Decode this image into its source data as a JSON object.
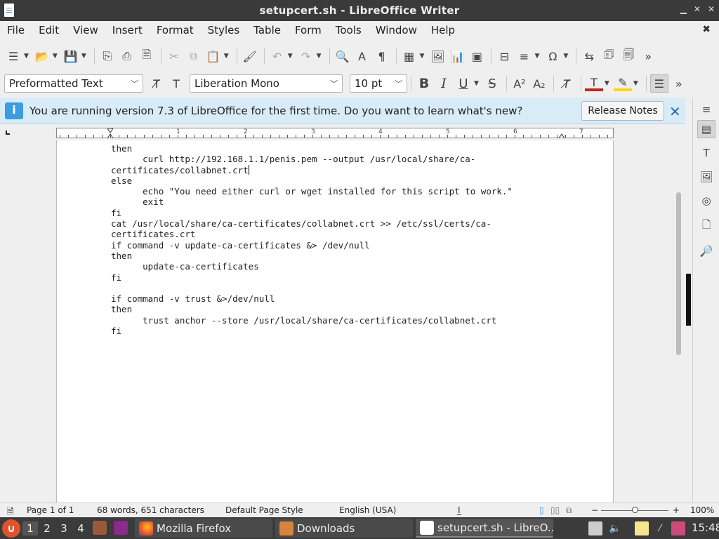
{
  "window": {
    "title": "setupcert.sh - LibreOffice Writer"
  },
  "menu": [
    "File",
    "Edit",
    "View",
    "Insert",
    "Format",
    "Styles",
    "Table",
    "Form",
    "Tools",
    "Window",
    "Help"
  ],
  "format_toolbar": {
    "paragraph_style": "Preformatted Text",
    "font_name": "Liberation Mono",
    "font_size": "10 pt"
  },
  "infobar": {
    "message": "You are running version 7.3 of LibreOffice for the first time. Do you want to learn what's new?",
    "button_label": "Release Notes"
  },
  "ruler": {
    "numbers": [
      "1",
      "2",
      "3",
      "4",
      "5",
      "6",
      "7"
    ]
  },
  "document": {
    "lines": [
      "then",
      "      curl http://192.168.1.1/penis.pem --output /usr/local/share/ca-",
      "certificates/collabnet.crt",
      "else",
      "      echo \"You need either curl or wget installed for this script to work.\"",
      "      exit",
      "fi",
      "cat /usr/local/share/ca-certificates/collabnet.crt >> /etc/ssl/certs/ca-",
      "certificates.crt",
      "if command -v update-ca-certificates &> /dev/null",
      "then",
      "      update-ca-certificates",
      "fi",
      "",
      "if command -v trust &>/dev/null",
      "then",
      "      trust anchor --store /usr/local/share/ca-certificates/collabnet.crt",
      "fi"
    ]
  },
  "status": {
    "page": "Page 1 of 1",
    "words": "68 words, 651 characters",
    "page_style": "Default Page Style",
    "language": "English (USA)",
    "zoom": "100%"
  },
  "taskbar": {
    "workspaces": [
      "1",
      "2",
      "3",
      "4"
    ],
    "tasks": [
      "Mozilla Firefox",
      "Downloads",
      "setupcert.sh - LibreO..."
    ],
    "clock": "15:48"
  },
  "colors": {
    "titlebar": "#3a3a3a",
    "infobar": "#d8ecf8",
    "font_color_bar": "#c9211e",
    "highlight_bar": "#ffd700",
    "taskbar": "#3b3b3b"
  }
}
